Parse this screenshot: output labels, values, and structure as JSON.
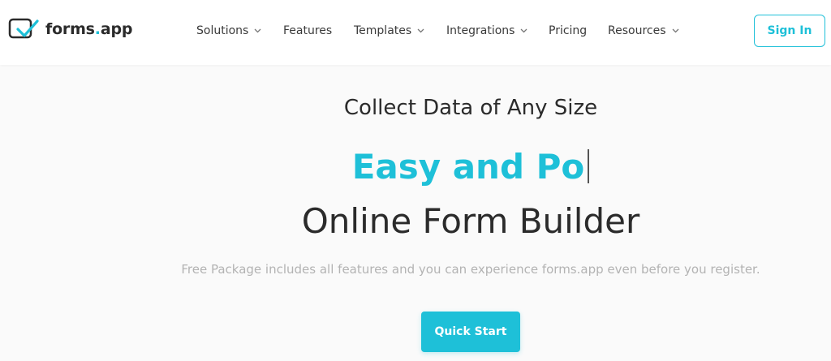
{
  "header": {
    "logo": {
      "brand": "forms",
      "dot": ".",
      "tld": "app"
    },
    "nav": [
      {
        "label": "Solutions",
        "has_dropdown": true
      },
      {
        "label": "Features",
        "has_dropdown": false
      },
      {
        "label": "Templates",
        "has_dropdown": true
      },
      {
        "label": "Integrations",
        "has_dropdown": true
      },
      {
        "label": "Pricing",
        "has_dropdown": false
      },
      {
        "label": "Resources",
        "has_dropdown": true
      }
    ],
    "signin_label": "Sign In"
  },
  "hero": {
    "subtitle": "Collect Data of Any Size",
    "typed_text": "Easy and Po",
    "title": "Online Form Builder",
    "description": "Free Package includes all features and you can experience forms.app even before you register.",
    "cta_label": "Quick Start"
  },
  "colors": {
    "accent": "#1ec0d8",
    "text": "#2b2b2b",
    "muted": "#b3b3b3",
    "background": "#fafafa"
  }
}
